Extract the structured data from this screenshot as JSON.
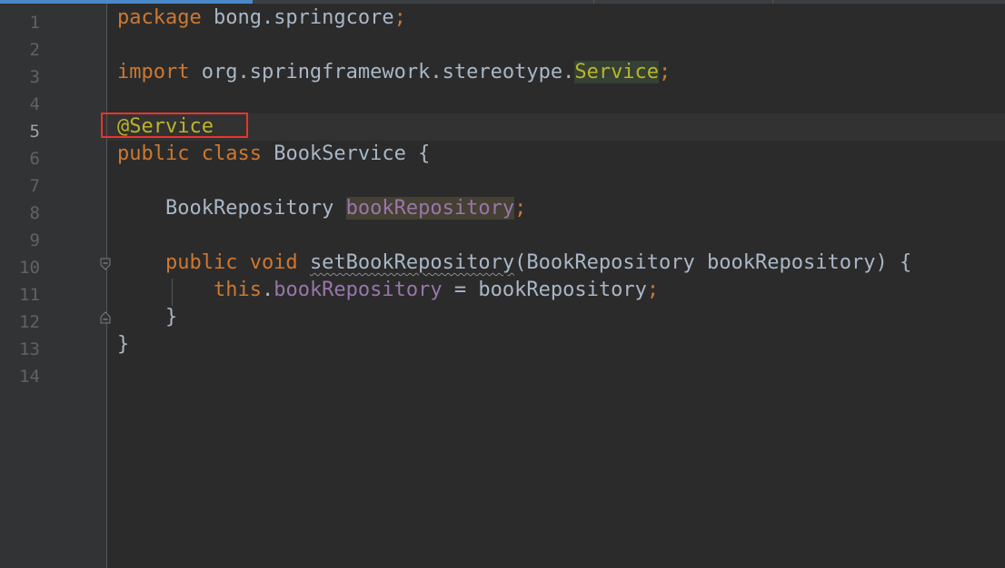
{
  "editor": {
    "line_numbers": [
      "1",
      "2",
      "3",
      "4",
      "5",
      "6",
      "7",
      "8",
      "9",
      "10",
      "11",
      "12",
      "13",
      "14"
    ],
    "current_line": "5",
    "code": {
      "l1": {
        "kw": "package",
        "rest": " bong.springcore",
        "semi": ";"
      },
      "l3": {
        "kw": "import",
        "rest": " org.springframework.stereotype.",
        "cls": "Service",
        "semi": ";"
      },
      "l5": {
        "annotation": "@Service"
      },
      "l6": {
        "kw": "public class",
        "rest": " BookService {"
      },
      "l8": {
        "indent": "    ",
        "type": "BookRepository ",
        "field": "bookRepository",
        "semi": ";"
      },
      "l10": {
        "indent": "    ",
        "kw": "public void",
        "sp": " ",
        "method": "setBookRepository",
        "params": "(BookRepository bookRepository) {"
      },
      "l11": {
        "indent": "        ",
        "kw": "this",
        "dot": ".",
        "field": "bookRepository",
        "rest": " = bookRepository",
        "semi": ";"
      },
      "l12": {
        "text": "    }"
      },
      "l13": {
        "text": "}"
      }
    },
    "colors": {
      "background": "#2b2b2b",
      "keyword": "#cc7832",
      "annotation": "#bbb529",
      "field": "#9876aa",
      "text": "#a9b7c6",
      "highlight_box": "#e8352b"
    }
  }
}
